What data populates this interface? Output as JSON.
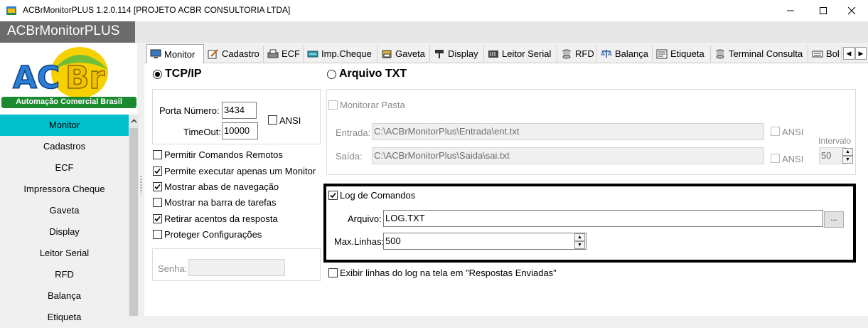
{
  "window": {
    "title": "ACBrMonitorPLUS 1.2.0.114  [PROJETO ACBR CONSULTORIA LTDA]",
    "icons": [
      "app-icon",
      "minimize-icon",
      "maximize-icon",
      "close-icon"
    ]
  },
  "brand": {
    "label": "ACBrMonitorPLUS"
  },
  "logo": {
    "text": "ACBr",
    "tagline": "Automação Comercial Brasil",
    "colors": [
      "#2a7fd4",
      "#f2c200",
      "#1b8a2f"
    ]
  },
  "sidebar": {
    "accent": "#00c0cc",
    "items": [
      {
        "label": "Monitor"
      },
      {
        "label": "Cadastros"
      },
      {
        "label": "ECF"
      },
      {
        "label": "Impressora Cheque"
      },
      {
        "label": "Gaveta"
      },
      {
        "label": "Display"
      },
      {
        "label": "Leitor Serial"
      },
      {
        "label": "RFD"
      },
      {
        "label": "Balança"
      },
      {
        "label": "Etiqueta"
      }
    ]
  },
  "tabs": [
    {
      "label": "Monitor",
      "icon": "monitor-icon"
    },
    {
      "label": "Cadastro",
      "icon": "edit-icon"
    },
    {
      "label": "ECF",
      "icon": "printer-icon"
    },
    {
      "label": "Imp.Cheque",
      "icon": "check-printer-icon"
    },
    {
      "label": "Gaveta",
      "icon": "drawer-icon"
    },
    {
      "label": "Display",
      "icon": "display-icon"
    },
    {
      "label": "Leitor Serial",
      "icon": "barcode-icon"
    },
    {
      "label": "RFD",
      "icon": "database-icon"
    },
    {
      "label": "Balança",
      "icon": "scale-icon"
    },
    {
      "label": "Etiqueta",
      "icon": "label-icon"
    },
    {
      "label": "Terminal Consulta",
      "icon": "database-icon"
    },
    {
      "label": "Bol",
      "icon": "keyboard-icon"
    }
  ],
  "tcp": {
    "title": "TCP/IP",
    "porta_label": "Porta Número:",
    "porta_value": "3434",
    "timeout_label": "TimeOut:",
    "timeout_value": "10000",
    "ansi_label": "ANSI"
  },
  "options": [
    {
      "label": "Permitir Comandos Remotos",
      "checked": false
    },
    {
      "label": "Permite executar apenas um Monitor",
      "checked": true
    },
    {
      "label": "Mostrar abas de navegação",
      "checked": true
    },
    {
      "label": "Mostrar na barra de tarefas",
      "checked": false
    },
    {
      "label": "Retirar acentos da resposta",
      "checked": true
    },
    {
      "label": "Proteger Configurações",
      "checked": false
    }
  ],
  "senha": {
    "label": "Senha:",
    "value": ""
  },
  "arquivo_txt": {
    "title": "Arquivo TXT",
    "monitorar_label": "Monitorar Pasta",
    "entrada_label": "Entrada:",
    "entrada_value": "C:\\ACBrMonitorPlus\\Entrada\\ent.txt",
    "saida_label": "Saída:",
    "saida_value": "C:\\ACBrMonitorPlus\\Saida\\sai.txt",
    "ansi_label": "ANSI",
    "intervalo_label": "Intervalo",
    "intervalo_value": "50"
  },
  "log": {
    "log_label": "Log de Comandos",
    "log_checked": true,
    "arquivo_label": "Arquivo:",
    "arquivo_value": "LOG.TXT",
    "browse_label": "...",
    "maxlinhas_label": "Max.Linhas:",
    "maxlinhas_value": "500",
    "exibir_label": "Exibir linhas do log na tela em \"Respostas Enviadas\"",
    "exibir_checked": false
  }
}
